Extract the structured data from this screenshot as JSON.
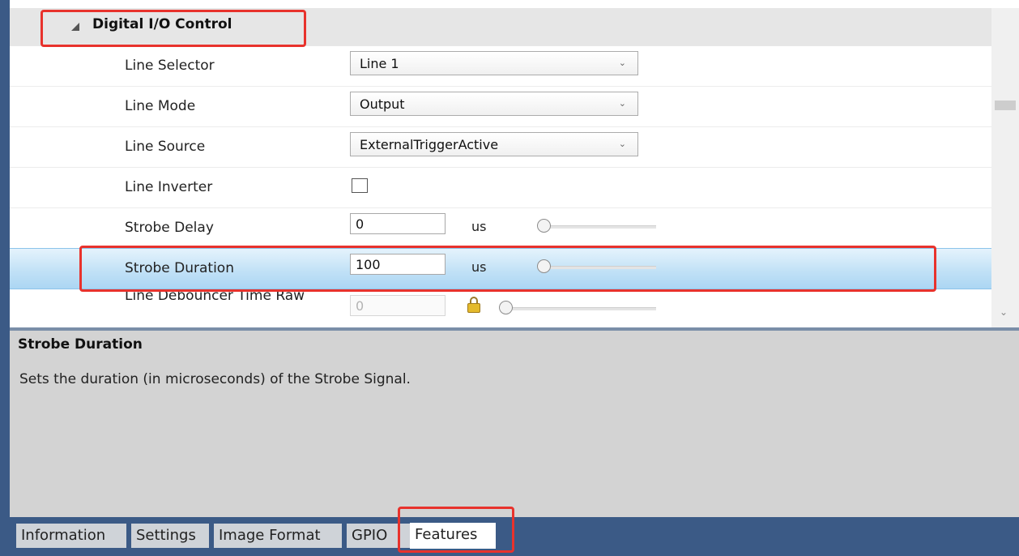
{
  "group": {
    "title": "Digital I/O Control"
  },
  "rows": [
    {
      "label": "Line Selector",
      "value": "Line 1"
    },
    {
      "label": "Line Mode",
      "value": "Output"
    },
    {
      "label": "Line Source",
      "value": "ExternalTriggerActive"
    },
    {
      "label": "Line Inverter",
      "checked": false
    },
    {
      "label": "Strobe Delay",
      "value": "0",
      "unit": "us"
    },
    {
      "label": "Strobe Duration",
      "value": "100",
      "unit": "us"
    },
    {
      "label": "Line Debouncer Time Raw",
      "value": "0"
    }
  ],
  "description": {
    "title": "Strobe Duration",
    "text": "Sets the duration (in microseconds) of the Strobe Signal."
  },
  "tabs": [
    {
      "label": "Information"
    },
    {
      "label": "Settings"
    },
    {
      "label": "Image Format"
    },
    {
      "label": "GPIO"
    },
    {
      "label": "Features",
      "active": true
    }
  ],
  "colors": {
    "frame": "#3b5a86",
    "selected_row": "#bfe0f6",
    "highlight": "#e8322c"
  }
}
